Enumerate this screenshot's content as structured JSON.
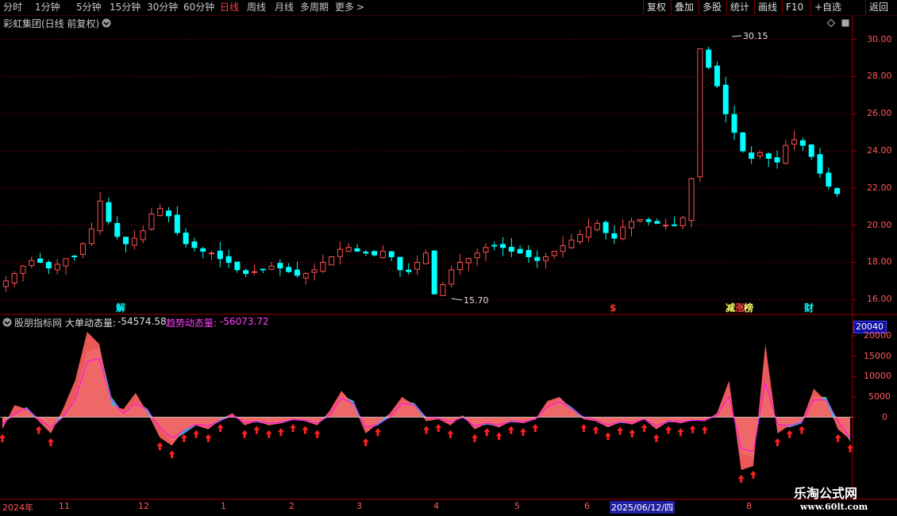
{
  "toolbar": {
    "periods": [
      "分时",
      "1分钟",
      "5分钟",
      "15分钟",
      "30分钟",
      "60分钟",
      "日线",
      "周线",
      "月线",
      "多周期",
      "更多"
    ],
    "active_period": "日线",
    "more_arrow": ">",
    "right_buttons": [
      "复权",
      "叠加",
      "多股",
      "统计",
      "画线",
      "F10",
      "+自选",
      "返回"
    ]
  },
  "title": {
    "text": "彩虹集团(日线 前复权)"
  },
  "price_axis": {
    "ticks": [
      "30.00",
      "28.00",
      "26.00",
      "24.00",
      "22.00",
      "20.00",
      "18.00",
      "16.00"
    ]
  },
  "annotations": {
    "high": "30.15",
    "low": "15.70"
  },
  "event_markers": [
    {
      "text": "解",
      "color": "#00ffff"
    },
    {
      "text": "$",
      "color": "#ff3030"
    },
    {
      "text": "减",
      "color": "#ffff66"
    },
    {
      "text": "涨",
      "color": "#ff4040"
    },
    {
      "text": "榜",
      "color": "#ffff66"
    },
    {
      "text": "财",
      "color": "#00ffff"
    }
  ],
  "indicator": {
    "source": "股朋指标网",
    "big_order_label": "大单动态量:",
    "big_order_value": "-54574.58",
    "trend_label": "趋势动态量:",
    "trend_value": "-56073.72",
    "axis_badge": "20040",
    "axis_ticks": [
      "20000",
      "15000",
      "10000",
      "5000",
      "0"
    ]
  },
  "time_axis": {
    "labels": [
      "2024年",
      "11",
      "12",
      "1",
      "2",
      "3",
      "4",
      "5",
      "6",
      "2025/06/12/四",
      "8"
    ]
  },
  "watermark": {
    "line1": "乐淘公式网",
    "line2": "www.60lt.com"
  },
  "colors": {
    "up": "#ff5050",
    "down": "#00ffff",
    "red_area": "#ff6060",
    "cyan_area": "#30d0d8",
    "trend_line": "#ff00ff",
    "arrow": "#ff2020"
  },
  "chart_data": [
    {
      "type": "candlestick",
      "title": "彩虹集团(日线 前复权)",
      "ylim": [
        15.2,
        30.5
      ],
      "y_ticks": [
        16,
        18,
        20,
        22,
        24,
        26,
        28,
        30
      ],
      "high": 30.15,
      "low": 15.7,
      "close_series": [
        17.0,
        17.4,
        17.8,
        18.1,
        18.0,
        17.7,
        17.9,
        18.2,
        18.3,
        19.0,
        19.8,
        21.3,
        20.2,
        19.4,
        19.0,
        19.3,
        19.7,
        20.6,
        20.9,
        20.5,
        19.6,
        19.0,
        18.8,
        18.6,
        18.5,
        18.2,
        18.0,
        17.6,
        17.4,
        17.5,
        17.6,
        17.8,
        17.7,
        17.5,
        17.3,
        17.4,
        17.6,
        18.0,
        18.3,
        18.7,
        18.8,
        18.6,
        18.5,
        18.4,
        18.6,
        18.3,
        17.6,
        17.5,
        18.0,
        18.5,
        16.3,
        16.8,
        17.6,
        18.0,
        18.2,
        18.5,
        18.8,
        18.9,
        18.8,
        18.6,
        18.5,
        18.3,
        18.1,
        18.3,
        18.6,
        18.9,
        19.2,
        19.5,
        19.9,
        20.1,
        19.6,
        19.3,
        19.9,
        20.2,
        20.3,
        20.2,
        20.1,
        20.0,
        20.0,
        20.4,
        22.5,
        29.5,
        28.5,
        27.5,
        26.0,
        25.0,
        24.0,
        23.6,
        23.9,
        23.6,
        23.4,
        24.3,
        24.6,
        24.3,
        23.7,
        22.8,
        22.1,
        21.7
      ]
    },
    {
      "type": "area",
      "title": "股朋指标网",
      "ylim": [
        -20000,
        21000
      ],
      "y_ticks": [
        0,
        5000,
        10000,
        15000,
        20000
      ],
      "series": [
        {
          "name": "大单动态量",
          "values": [
            -3000,
            3000,
            2000,
            -1000,
            -4000,
            2000,
            9000,
            21000,
            18000,
            3000,
            2000,
            6000,
            1000,
            -5000,
            -7000,
            -3000,
            -2000,
            -3000,
            -500,
            1000,
            -2000,
            -1000,
            -2000,
            -1500,
            -500,
            -1000,
            -2000,
            1500,
            6500,
            3000,
            -4000,
            -1500,
            1000,
            5000,
            3000,
            -1000,
            -500,
            -2000,
            500,
            -3000,
            -1500,
            -2500,
            -1000,
            -1500,
            -500,
            4000,
            5000,
            2000,
            -500,
            -1000,
            -2500,
            -1200,
            -1800,
            -500,
            -3000,
            -1000,
            -1500,
            -800,
            -1000,
            1000,
            9000,
            -13000,
            -12000,
            18000,
            -4000,
            -2000,
            -1000,
            7000,
            4000,
            -3000,
            -5500
          ]
        },
        {
          "name": "趋势动态量",
          "values": [
            -2000,
            1000,
            2500,
            -500,
            -3000,
            0,
            5000,
            16000,
            17000,
            5000,
            1000,
            4000,
            2000,
            -3000,
            -6000,
            -4000,
            -2000,
            -2500,
            -1000,
            500,
            -1500,
            -1200,
            -1800,
            -1500,
            -700,
            -900,
            -1800,
            500,
            5500,
            4000,
            -3000,
            -2000,
            0,
            4000,
            3500,
            0,
            -300,
            -1500,
            0,
            -2500,
            -1800,
            -2200,
            -1200,
            -1400,
            -600,
            3000,
            4500,
            2500,
            0,
            -800,
            -2200,
            -1400,
            -1600,
            -600,
            -2500,
            -1200,
            -1300,
            -900,
            -900,
            500,
            6000,
            -9000,
            -10000,
            10000,
            -2000,
            -2500,
            -1500,
            5000,
            5000,
            -1000,
            -6000
          ]
        },
        {
          "name": "买入信号"
        }
      ],
      "value_labels": {
        "大单动态量": -54574.58,
        "趋势动态量": -56073.72
      }
    }
  ]
}
